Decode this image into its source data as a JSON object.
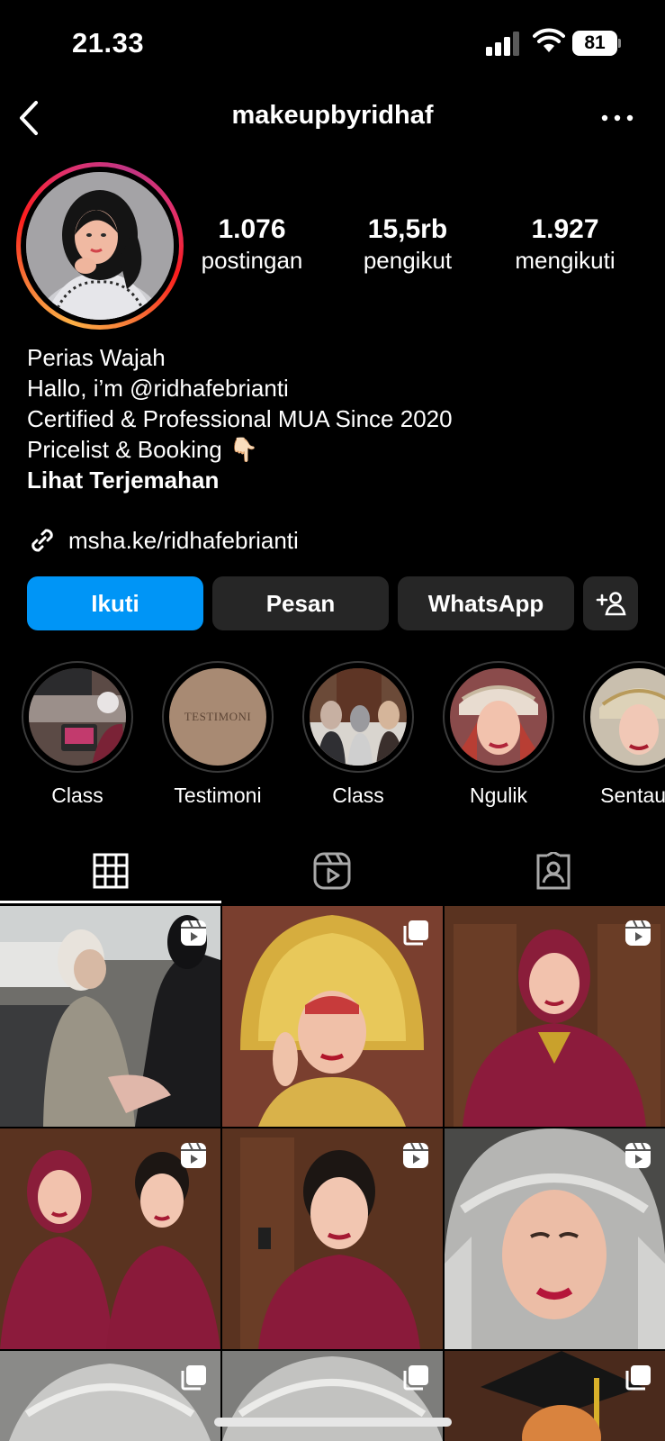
{
  "status_bar": {
    "time": "21.33",
    "battery": "81"
  },
  "header": {
    "username": "makeupbyridhaf"
  },
  "stats": [
    {
      "value": "1.076",
      "label": "postingan"
    },
    {
      "value": "15,5rb",
      "label": "pengikut"
    },
    {
      "value": "1.927",
      "label": "mengikuti"
    }
  ],
  "bio": {
    "category": "Perias Wajah",
    "line1": "Hallo, i’m @ridhafebrianti",
    "line2": "Certified & Professional MUA Since 2020",
    "line3": "Pricelist & Booking",
    "emoji": "👇🏻",
    "translate": "Lihat Terjemahan"
  },
  "link": {
    "text": "msha.ke/ridhafebrianti"
  },
  "buttons": {
    "follow": "Ikuti",
    "message": "Pesan",
    "whatsapp": "WhatsApp"
  },
  "highlights": [
    {
      "label": "Class",
      "inner_text": ""
    },
    {
      "label": "Testimoni",
      "inner_text": "TESTIMONI"
    },
    {
      "label": "Class",
      "inner_text": ""
    },
    {
      "label": "Ngulik",
      "inner_text": ""
    },
    {
      "label": "Sentauri",
      "inner_text": ""
    }
  ],
  "tabs": [
    {
      "name": "grid-icon"
    },
    {
      "name": "reels-icon"
    },
    {
      "name": "tagged-icon"
    }
  ],
  "colors": {
    "follow_button": "#0095f6",
    "secondary_button": "#262626",
    "background": "#000000"
  },
  "grid_posts": [
    {
      "type": "reel"
    },
    {
      "type": "carousel"
    },
    {
      "type": "reel"
    },
    {
      "type": "reel"
    },
    {
      "type": "reel"
    },
    {
      "type": "reel"
    },
    {
      "type": "carousel"
    },
    {
      "type": "carousel"
    },
    {
      "type": "carousel"
    }
  ]
}
